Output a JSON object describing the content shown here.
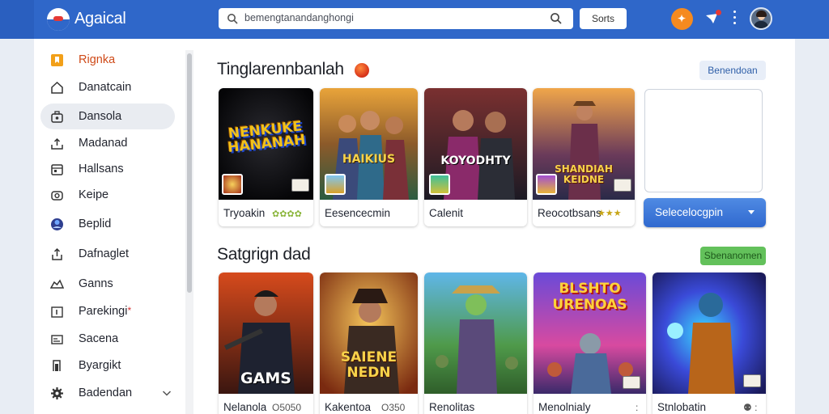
{
  "app": {
    "title": "Agaical"
  },
  "search": {
    "value": "bemengtanandanghongi"
  },
  "topbar": {
    "sort_label": "Sorts",
    "accent_color": "#2f67c9"
  },
  "sidebar": {
    "items": [
      {
        "label": "Rignka",
        "icon": "bookmark-icon",
        "active": false
      },
      {
        "label": "Danatcain",
        "icon": "home-icon",
        "active": false
      },
      {
        "label": "Dansola",
        "icon": "briefcase-icon",
        "active": true
      },
      {
        "label": "Madanad",
        "icon": "upload-icon",
        "active": false
      },
      {
        "label": "Hallsans",
        "icon": "calendar-icon",
        "active": false
      },
      {
        "label": "Keipe",
        "icon": "camera-icon",
        "active": false
      },
      {
        "label": "Beplid",
        "icon": "globe-icon",
        "active": false
      },
      {
        "label": "Dafnaglet",
        "icon": "share-icon",
        "active": false
      },
      {
        "label": "Ganns",
        "icon": "game-icon",
        "active": false
      },
      {
        "label": "Parekingi",
        "icon": "chart-icon",
        "active": false,
        "marker": "*"
      },
      {
        "label": "Sacena",
        "icon": "mail-icon",
        "active": false
      },
      {
        "label": "Byargikt",
        "icon": "door-icon",
        "active": false
      },
      {
        "label": "Badendan",
        "icon": "gear-icon",
        "active": false,
        "expandable": true
      }
    ]
  },
  "section1": {
    "title": "Tinglarennbanlah",
    "action_label": "Benendoan",
    "cards": [
      {
        "art_title": "NENKUKE HANANAH",
        "caption": "Tryoakin",
        "rating": "✿✿✿✿"
      },
      {
        "art_title": "HAIKIUS",
        "caption": "Eesencecmin"
      },
      {
        "art_title": "KOYODHTY",
        "caption": "Calenit"
      },
      {
        "art_title": "SHANDIAH KEIDNE",
        "caption": "Reocotbsans",
        "rating": "★★★"
      }
    ],
    "select_label": "Selecelocgpin"
  },
  "section2": {
    "title": "Satgrign dad",
    "action_label": "Sbenanomen",
    "cards": [
      {
        "art_title": "GAMS",
        "caption": "Nelanola",
        "meta": "O5050"
      },
      {
        "art_title": "SAIENE NEDN",
        "caption": "Kakentoa",
        "meta": "O350"
      },
      {
        "art_title": "",
        "caption": "Renolitas",
        "meta": ""
      },
      {
        "art_title": "BLSHTO URENOAS",
        "caption": "Menolnialy",
        "meta": ":"
      },
      {
        "art_title": "",
        "caption": "Stnlobatin",
        "meta": "⚉ :"
      }
    ]
  }
}
